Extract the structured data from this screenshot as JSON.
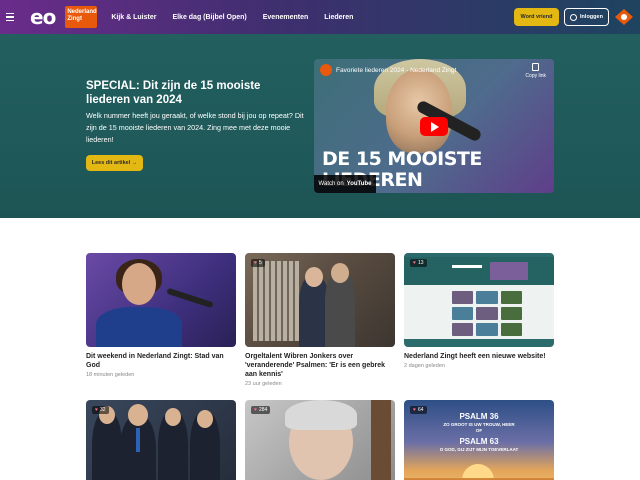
{
  "header": {
    "logo": "eo",
    "brand": "Nederland Zingt",
    "nav": [
      "Kijk & Luister",
      "Elke dag (Bijbel Open)",
      "Evenementen",
      "Liederen"
    ],
    "become_friend": "Word vriend",
    "login": "Inloggen"
  },
  "hero": {
    "title": "SPECIAL: Dit zijn de 15 mooiste liederen van 2024",
    "description": "Welk nummer heeft jou geraakt, of welke stond bij jou op repeat? Dit zijn de 15 mooiste liederen van 2024. Zing mee met deze mooie liederen!",
    "cta": "Lees dit artikel →",
    "video": {
      "title": "Favoriete liederen 2024 - Nederland Zingt",
      "copy_link": "Copy link",
      "big_text": "DE 15 MOOISTE LIEDEREN",
      "watch_on": "Watch on",
      "youtube": "YouTube"
    }
  },
  "cards": [
    {
      "title": "Dit weekend in Nederland Zingt: Stad van God",
      "time": "18 minuten geleden",
      "likes": ""
    },
    {
      "title": "Orgeltalent Wibren Jonkers over 'veranderende' Psalmen: 'Er is een gebrek aan kennis'",
      "time": "23 uur geleden",
      "likes": "5"
    },
    {
      "title": "Nederland Zingt heeft een nieuwe website!",
      "time": "2 dagen geleden",
      "likes": "13"
    },
    {
      "title": "",
      "time": "",
      "likes": "32"
    },
    {
      "title": "",
      "time": "",
      "likes": "284"
    },
    {
      "title": "",
      "time": "",
      "likes": "64",
      "thumb_text": [
        "PSALM 36",
        "ZO GROOT IS UW TROUW, HEER",
        "OF",
        "PSALM 63",
        "O GOD, GIJ ZIJT MIJN TOEVERLAAT"
      ]
    }
  ],
  "colors": {
    "header_gradient_start": "#6a2c8a",
    "hero_bg": "#235f5f",
    "accent_yellow": "#e4b812",
    "npo_orange": "#e8590c"
  }
}
